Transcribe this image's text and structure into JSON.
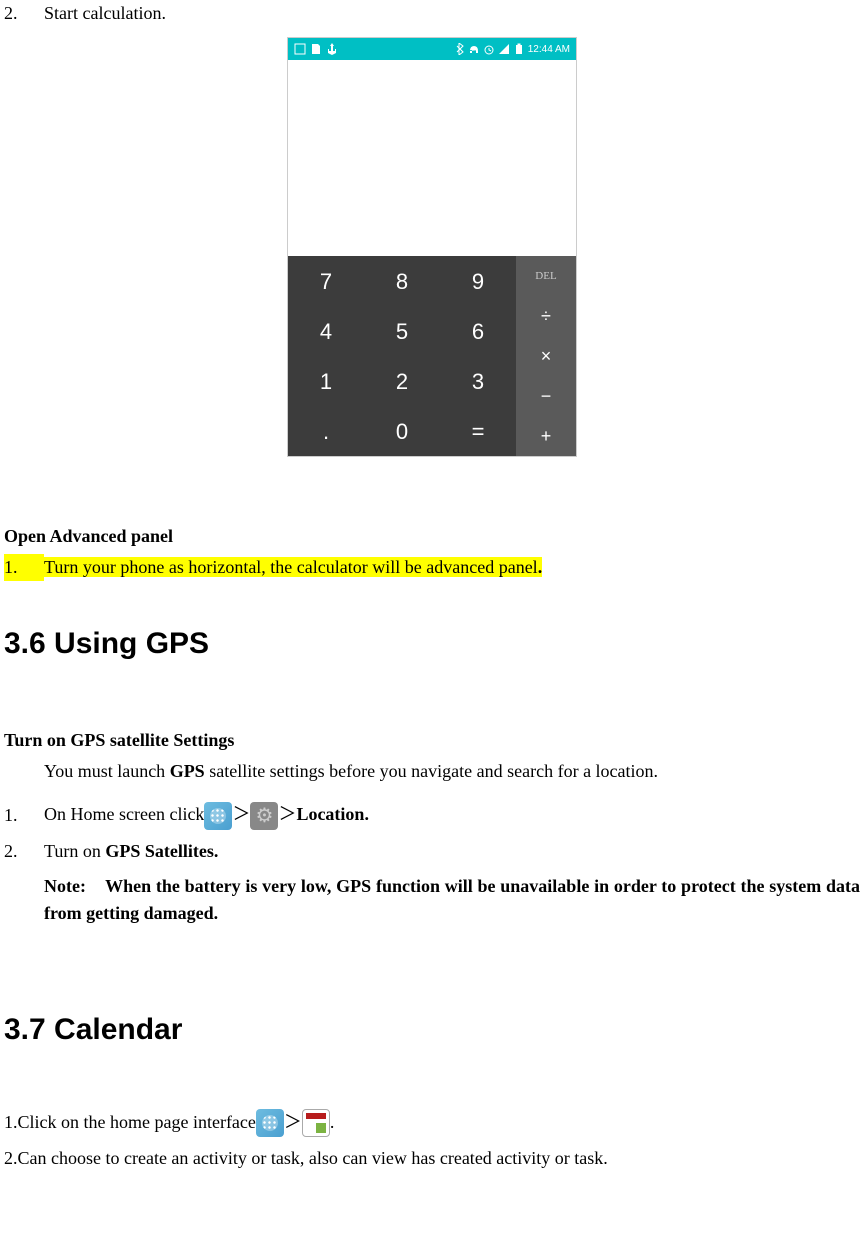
{
  "item2": {
    "num": "2.",
    "text": "Start calculation."
  },
  "phone": {
    "status": {
      "time": "12:44 AM"
    },
    "calc": {
      "keys": [
        "7",
        "8",
        "9",
        "4",
        "5",
        "6",
        "1",
        "2",
        "3",
        ".",
        "0",
        "="
      ],
      "del": "DEL",
      "ops": [
        "÷",
        "×",
        "−",
        "+"
      ]
    }
  },
  "advanced": {
    "heading": "Open Advanced panel",
    "num": "1.",
    "text": "Turn your phone as horizontal, the calculator will be advanced panel",
    "dot": "."
  },
  "gps": {
    "heading": "3.6 Using GPS",
    "sub": "Turn on GPS satellite Settings",
    "intro_a": "You must launch ",
    "intro_b": "GPS",
    "intro_c": " satellite settings before you navigate and search for a location.",
    "s1": {
      "num": "1.",
      "a": "On Home screen click",
      "arrow": "＞",
      "b": "Location."
    },
    "s2": {
      "num": "2.",
      "a": "Turn on ",
      "b": "GPS Satellites."
    },
    "note_label": "Note:",
    "note_text": "When the battery is very low, GPS function will be unavailable in order to protect the system data from getting damaged."
  },
  "cal": {
    "heading": "3.7 Calendar",
    "s1": {
      "a": "1.Click on the home page interface",
      "arrow": "＞",
      "dot": "."
    },
    "s2": "2.Can choose to create an activity or task, also can view has created activity or task."
  }
}
